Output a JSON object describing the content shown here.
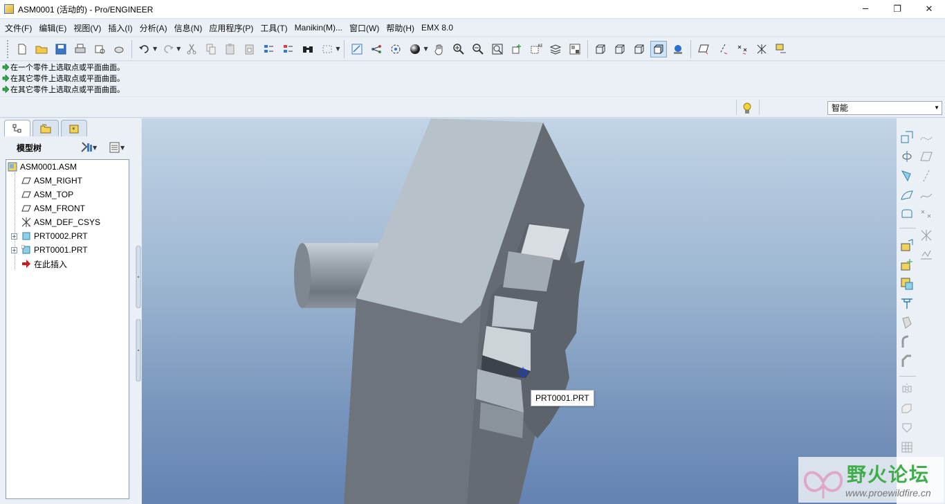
{
  "window": {
    "title": "ASM0001 (活动的) - Pro/ENGINEER",
    "minimize": "─",
    "maximize": "❐",
    "close": "✕"
  },
  "menu": [
    {
      "label": "文件(F)"
    },
    {
      "label": "编辑(E)"
    },
    {
      "label": "视图(V)"
    },
    {
      "label": "插入(I)"
    },
    {
      "label": "分析(A)"
    },
    {
      "label": "信息(N)"
    },
    {
      "label": "应用程序(P)"
    },
    {
      "label": "工具(T)"
    },
    {
      "label": "Manikin(M)..."
    },
    {
      "label": "窗口(W)"
    },
    {
      "label": "帮助(H)"
    },
    {
      "label": "EMX 8.0"
    }
  ],
  "messages": [
    {
      "text": "在一个零件上选取点或平面曲面。"
    },
    {
      "text": "在其它零件上选取点或平面曲面。"
    },
    {
      "text": "在其它零件上选取点或平面曲面。"
    }
  ],
  "filter": {
    "value": "智能"
  },
  "model_tree": {
    "header": "模型树",
    "items": [
      {
        "label": "ASM0001.ASM",
        "icon": "assembly-icon"
      },
      {
        "label": "ASM_RIGHT",
        "icon": "datum-plane-icon"
      },
      {
        "label": "ASM_TOP",
        "icon": "datum-plane-icon"
      },
      {
        "label": "ASM_FRONT",
        "icon": "datum-plane-icon"
      },
      {
        "label": "ASM_DEF_CSYS",
        "icon": "coordinate-system-icon"
      },
      {
        "label": "PRT0002.PRT",
        "icon": "part-icon"
      },
      {
        "label": "PRT0001.PRT",
        "icon": "part-icon"
      },
      {
        "label": "在此插入",
        "icon": "insert-here-arrow-icon"
      }
    ]
  },
  "graphics": {
    "tooltip": "PRT0001.PRT"
  },
  "watermark": {
    "title": "野火论坛",
    "url": "www.proewildfire.cn"
  }
}
